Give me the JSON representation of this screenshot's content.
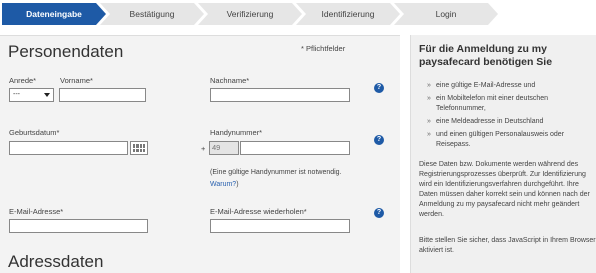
{
  "steps": [
    "Dateneingabe",
    "Bestätigung",
    "Verifizierung",
    "Identifizierung",
    "Login"
  ],
  "form": {
    "title": "Personendaten",
    "required_note": "* Pflichtfelder",
    "anrede_label": "Anrede*",
    "anrede_value": "---",
    "vorname_label": "Vorname*",
    "nachname_label": "Nachname*",
    "geburtsdatum_label": "Geburtsdatum*",
    "handy_label": "Handynummer*",
    "handy_plus": "+",
    "handy_prefix": "49",
    "handy_note": "(Eine gültige Handynummer ist notwendig.",
    "handy_link": "Warum?",
    "handy_note_end": ")",
    "email_label": "E-Mail-Adresse*",
    "email_repeat_label": "E-Mail-Adresse wiederholen*",
    "section2_title": "Adressdaten",
    "help_glyph": "?"
  },
  "side": {
    "title": "Für die Anmeldung zu my paysafecard benötigen Sie",
    "items": [
      "eine gültige E-Mail-Adresse und",
      "ein Mobiltelefon mit einer deutschen Telefonnummer,",
      "eine Meldeadresse in Deutschland",
      "und einen gültigen Personalausweis oder Reisepass."
    ],
    "para1": "Diese Daten bzw. Dokumente werden während des Registrierungsprozesses überprüft. Zur Identifizierung wird ein Identifizierungsverfahren durchgeführt. Ihre Daten müssen daher korrekt sein und können nach der Anmeldung zu my paysafecard nicht mehr geändert werden.",
    "para2": "Bitte stellen Sie sicher, dass JavaScript in Ihrem Browser aktiviert ist."
  },
  "colors": {
    "active_step": "#1e5aa6",
    "inactive_step": "#e6e6e6",
    "help_icon": "#1e5aa6",
    "link": "#2a62b0"
  }
}
